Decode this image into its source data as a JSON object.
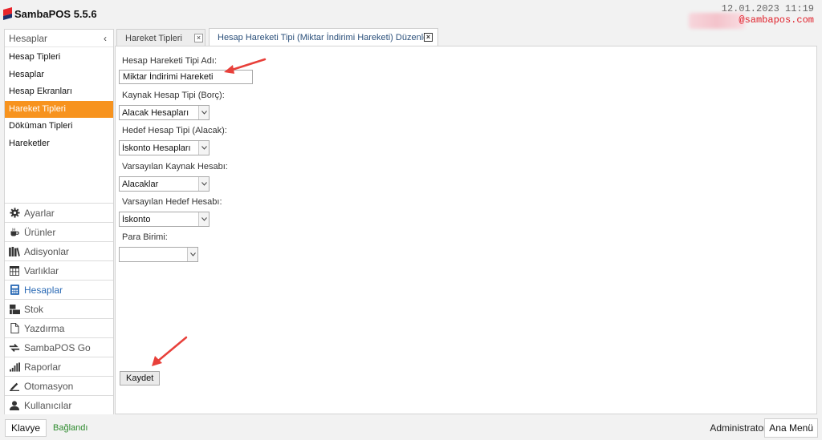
{
  "app": {
    "title": "SambaPOS 5.5.6",
    "logo_icon": "sambapos-logo-icon",
    "clock": "12.01.2023 11:19",
    "user_email": "@sambapos.com"
  },
  "sidebar": {
    "header": "Hesaplar",
    "collapse_glyph": "‹",
    "items": [
      {
        "label": "Hesap Tipleri"
      },
      {
        "label": "Hesaplar"
      },
      {
        "label": "Hesap Ekranları"
      },
      {
        "label": "Hareket Tipleri",
        "active": true
      },
      {
        "label": "Döküman Tipleri"
      },
      {
        "label": "Hareketler"
      }
    ],
    "modules": [
      {
        "label": "Ayarlar",
        "icon": "gear-icon"
      },
      {
        "label": "Ürünler",
        "icon": "coffee-cup-icon"
      },
      {
        "label": "Adisyonlar",
        "icon": "books-icon"
      },
      {
        "label": "Varlıklar",
        "icon": "table-icon"
      },
      {
        "label": "Hesaplar",
        "icon": "calculator-icon",
        "active": true
      },
      {
        "label": "Stok",
        "icon": "stock-icon"
      },
      {
        "label": "Yazdırma",
        "icon": "document-icon"
      },
      {
        "label": "SambaPOS Go",
        "icon": "sync-icon"
      },
      {
        "label": "Raporlar",
        "icon": "bar-chart-icon"
      },
      {
        "label": "Otomasyon",
        "icon": "pencil-icon"
      },
      {
        "label": "Kullanıcılar",
        "icon": "user-icon"
      }
    ]
  },
  "tabs": [
    {
      "label": "Hareket Tipleri",
      "close": "×"
    },
    {
      "label": "Hesap Hareketi Tipi (Miktar İndirimi Hareketi) Düzenle",
      "close": "×",
      "active": true
    }
  ],
  "form": {
    "name_label": "Hesap Hareketi Tipi Adı:",
    "name_value": "Miktar İndirimi Hareketi",
    "source_type_label": "Kaynak Hesap Tipi (Borç):",
    "source_type_value": "Alacak Hesapları",
    "target_type_label": "Hedef Hesap Tipi (Alacak):",
    "target_type_value": "İskonto Hesapları",
    "default_source_label": "Varsayılan Kaynak Hesabı:",
    "default_source_value": "Alacaklar",
    "default_target_label": "Varsayılan Hedef Hesabı:",
    "default_target_value": "İskonto",
    "currency_label": "Para Birimi:",
    "currency_value": "",
    "save_label": "Kaydet"
  },
  "annotation_color": "#e8403a",
  "statusbar": {
    "keyboard_label": "Klavye",
    "connection_status": "Bağlandı",
    "user": "Administrator",
    "main_menu_label": "Ana Menü"
  }
}
